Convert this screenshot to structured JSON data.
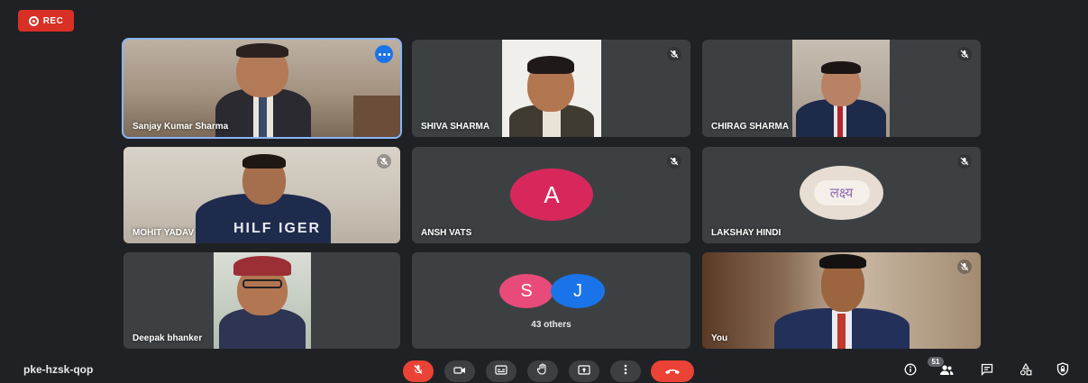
{
  "recording": {
    "label": "REC"
  },
  "tiles": [
    {
      "name": "Sanjay Kumar Sharma"
    },
    {
      "name": "SHIVA SHARMA"
    },
    {
      "name": "CHIRAG SHARMA"
    },
    {
      "name": "MOHIT YADAV",
      "shirt_text": "HILF IGER"
    },
    {
      "name": "ANSH VATS",
      "avatar_letter": "A",
      "avatar_color": "#d8285b"
    },
    {
      "name": "LAKSHAY HINDI",
      "logo_text": "लक्ष्य"
    },
    {
      "name": "Deepak bhanker"
    },
    {
      "others_label": "43 others",
      "avatars": [
        {
          "letter": "S",
          "color": "#e84b7a"
        },
        {
          "letter": "J",
          "color": "#1a73e8"
        }
      ]
    },
    {
      "name": "You"
    }
  ],
  "meeting": {
    "code": "pke-hzsk-qop"
  },
  "controls": [
    "mic-off",
    "camera",
    "captions",
    "raise-hand",
    "present",
    "more-options",
    "leave-call"
  ],
  "right_controls": {
    "people_count": "51",
    "items": [
      "meeting-details",
      "people",
      "chat",
      "activities",
      "host-controls"
    ]
  },
  "colors": {
    "background": "#202124",
    "tile": "#3c4043",
    "accent": "#8ab4f8",
    "danger": "#ea4335"
  }
}
